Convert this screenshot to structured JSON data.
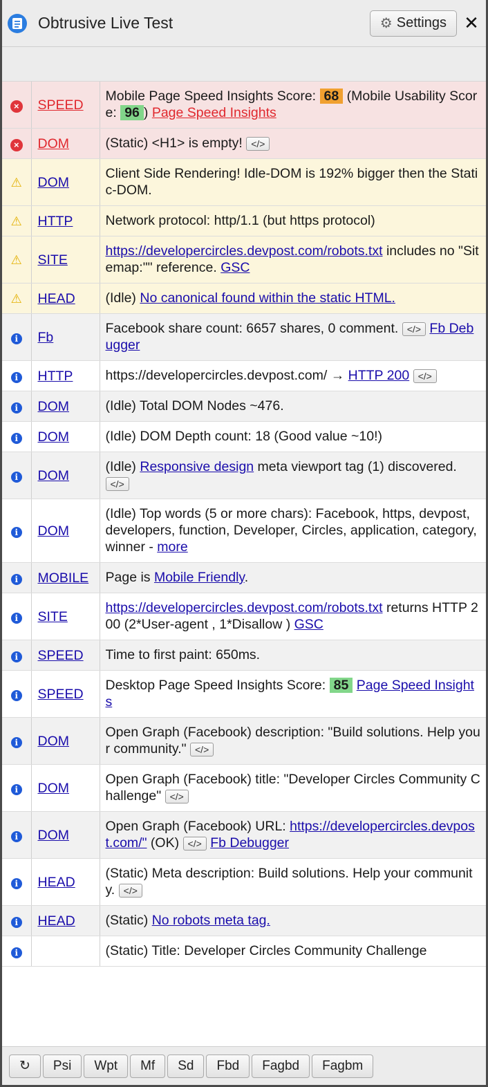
{
  "window": {
    "title": "Obtrusive Live Test",
    "settings_label": "Settings",
    "close_glyph": "✕"
  },
  "icons": {
    "error": "×",
    "warning": "⚠",
    "info": "i",
    "gear": "⚙",
    "refresh": "↻"
  },
  "rows": [
    {
      "status": "err",
      "category": "SPEED",
      "parts": [
        {
          "t": "Mobile Page Speed Insights Score: "
        },
        {
          "badge": "68",
          "color": "orange"
        },
        {
          "t": " (Mobile Usability Score: "
        },
        {
          "badge": "96",
          "color": "green"
        },
        {
          "t": ") "
        },
        {
          "link": "Page Speed Insights",
          "red": true
        }
      ]
    },
    {
      "status": "err",
      "category": "DOM",
      "parts": [
        {
          "t": "(Static) <H1> is empty! "
        },
        {
          "code": "</>"
        }
      ]
    },
    {
      "status": "warn",
      "category": "DOM",
      "parts": [
        {
          "t": "Client Side Rendering! Idle-DOM is 192% bigger then the Static-DOM."
        }
      ]
    },
    {
      "status": "warn",
      "category": "HTTP",
      "parts": [
        {
          "t": "Network protocol: http/1.1 (but https protocol)"
        }
      ]
    },
    {
      "status": "warn",
      "category": "SITE",
      "parts": [
        {
          "link": "https://developercircles.devpost.com/robots.txt"
        },
        {
          "t": " includes no \"Sitemap:\"\" reference. "
        },
        {
          "link": "GSC"
        }
      ]
    },
    {
      "status": "warn",
      "category": "HEAD",
      "parts": [
        {
          "t": "(Idle) "
        },
        {
          "link": "No canonical found within the static HTML."
        }
      ]
    },
    {
      "status": "info",
      "category": "Fb",
      "parts": [
        {
          "t": "Facebook share count: 6657 shares, 0 comment. "
        },
        {
          "code": "</>"
        },
        {
          "t": " "
        },
        {
          "link": "Fb Debugger"
        }
      ]
    },
    {
      "status": "info",
      "category": "HTTP",
      "parts": [
        {
          "t": "https://developercircles.devpost.com/ → "
        },
        {
          "link": "HTTP 200"
        },
        {
          "t": " "
        },
        {
          "code": "</>"
        }
      ]
    },
    {
      "status": "info",
      "category": "DOM",
      "parts": [
        {
          "t": "(Idle) Total DOM Nodes ~476."
        }
      ]
    },
    {
      "status": "info",
      "category": "DOM",
      "parts": [
        {
          "t": "(Idle) DOM Depth count: 18 (Good value ~10!)"
        }
      ]
    },
    {
      "status": "info",
      "category": "DOM",
      "parts": [
        {
          "t": "(Idle) "
        },
        {
          "link": "Responsive design"
        },
        {
          "t": " meta viewport tag (1) discovered. "
        },
        {
          "code": "</>"
        }
      ]
    },
    {
      "status": "info",
      "category": "DOM",
      "parts": [
        {
          "t": "(Idle) Top words (5 or more chars): Facebook, https, devpost, developers, function, Developer, Circles, application, category, winner - "
        },
        {
          "link": "more"
        }
      ]
    },
    {
      "status": "info",
      "category": "MOBILE",
      "parts": [
        {
          "t": "Page is "
        },
        {
          "link": "Mobile Friendly"
        },
        {
          "t": "."
        }
      ]
    },
    {
      "status": "info",
      "category": "SITE",
      "parts": [
        {
          "link": "https://developercircles.devpost.com/robots.txt"
        },
        {
          "t": " returns HTTP 200 (2*User-agent , 1*Disallow ) "
        },
        {
          "link": "GSC"
        }
      ]
    },
    {
      "status": "info",
      "category": "SPEED",
      "parts": [
        {
          "t": "Time to first paint: 650ms."
        }
      ]
    },
    {
      "status": "info",
      "category": "SPEED",
      "parts": [
        {
          "t": "Desktop Page Speed Insights Score: "
        },
        {
          "badge": "85",
          "color": "green"
        },
        {
          "t": " "
        },
        {
          "link": "Page Speed Insights"
        }
      ]
    },
    {
      "status": "info",
      "category": "DOM",
      "parts": [
        {
          "t": "Open Graph (Facebook) description: \"Build solutions. Help your community.\" "
        },
        {
          "code": "</>"
        }
      ]
    },
    {
      "status": "info",
      "category": "DOM",
      "parts": [
        {
          "t": "Open Graph (Facebook) title: \"Developer Circles Community Challenge\" "
        },
        {
          "code": "</>"
        }
      ]
    },
    {
      "status": "info",
      "category": "DOM",
      "parts": [
        {
          "t": "Open Graph (Facebook) URL: "
        },
        {
          "link": "https://developercircles.devpost.com/\""
        },
        {
          "t": " (OK) "
        },
        {
          "code": "</>"
        },
        {
          "t": " "
        },
        {
          "link": "Fb Debugger"
        }
      ]
    },
    {
      "status": "info",
      "category": "HEAD",
      "parts": [
        {
          "t": "(Static) Meta description: Build solutions. Help your community. "
        },
        {
          "code": "</>"
        }
      ]
    },
    {
      "status": "info",
      "category": "HEAD",
      "parts": [
        {
          "t": "(Static) "
        },
        {
          "link": "No robots meta tag."
        }
      ]
    },
    {
      "status": "info",
      "category": "",
      "parts": [
        {
          "t": "(Static) Title: Developer Circles Community Challenge"
        }
      ]
    }
  ],
  "footer": {
    "buttons": [
      "↻",
      "Psi",
      "Wpt",
      "Mf",
      "Sd",
      "Fbd",
      "Fagbd",
      "Fagbm"
    ]
  }
}
